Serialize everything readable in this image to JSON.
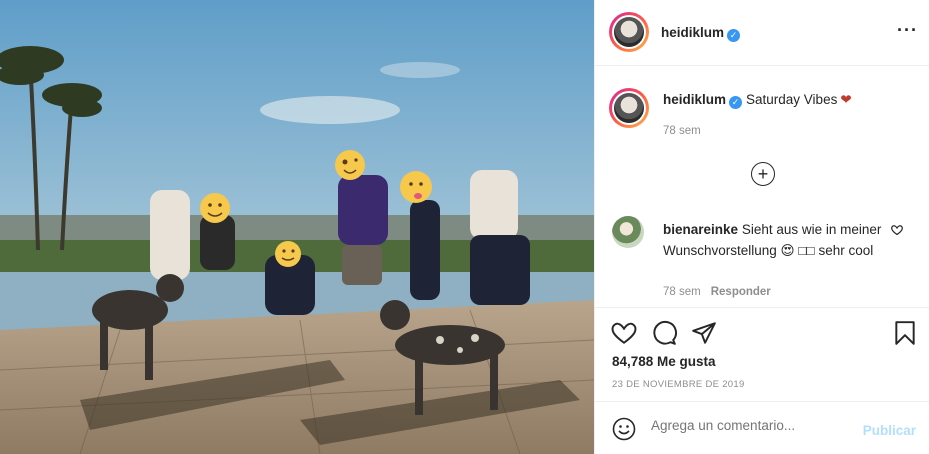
{
  "post": {
    "username": "heidiklum",
    "verified_icon": "verified-badge-icon",
    "more_icon": "more-options-icon",
    "caption": "Saturday Vibes",
    "caption_emoji": "❤",
    "time": "78 sem",
    "load_more_icon": "plus-circle-icon"
  },
  "comments": [
    {
      "username": "bienareinke",
      "text": "Sieht aus wie in meiner Wunschvorstellung 😍 □□ sehr cool",
      "time": "78 sem",
      "reply_label": "Responder"
    }
  ],
  "actions": {
    "icons": [
      "heart-icon",
      "comment-icon",
      "share-icon",
      "bookmark-icon"
    ],
    "likes": "84,788 Me gusta",
    "date": "23 DE NOVIEMBRE DE 2019"
  },
  "comment_box": {
    "placeholder": "Agrega un comentario...",
    "publish_label": "Publicar"
  },
  "colors": {
    "verified": "#3897f0",
    "publish_disabled": "#b2dffc",
    "secondary_text": "#8e8e8e"
  }
}
